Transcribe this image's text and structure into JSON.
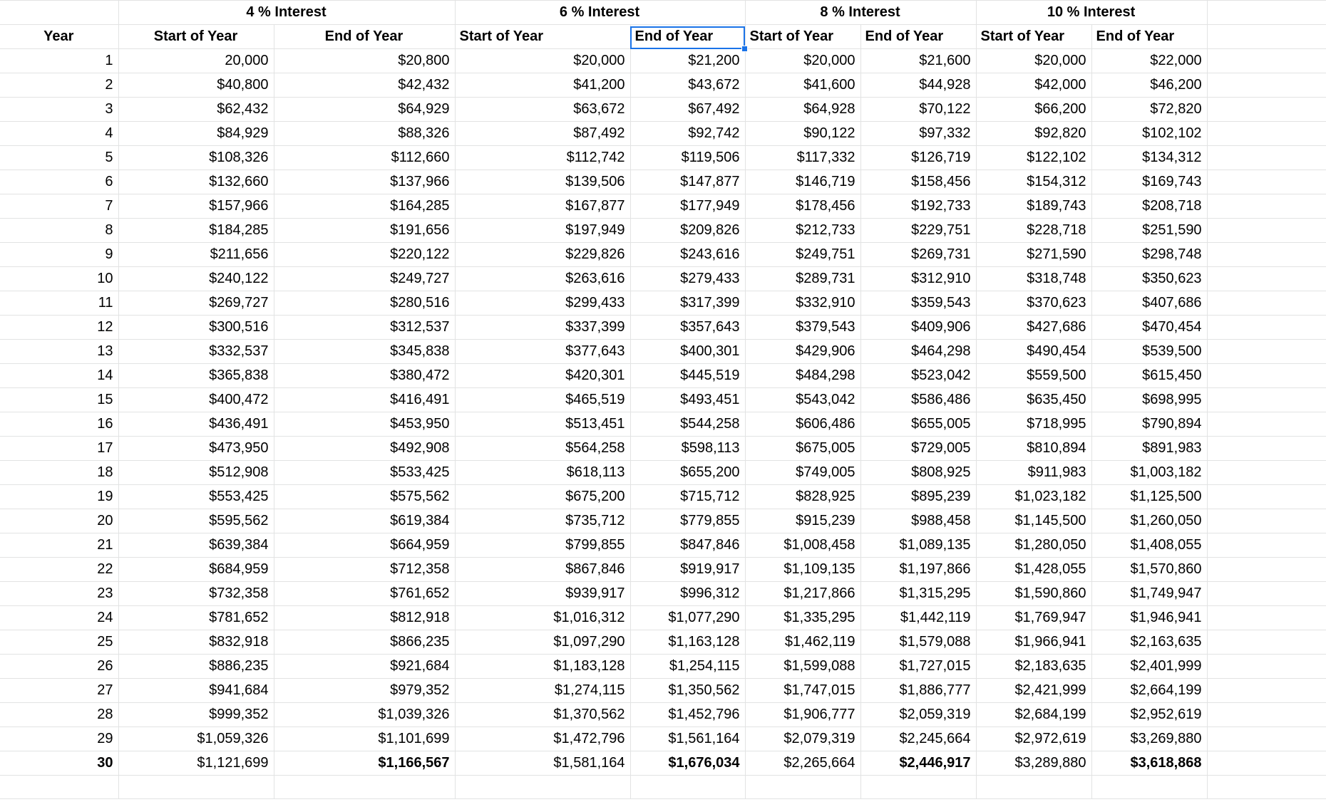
{
  "headers": {
    "year": "Year",
    "groups": [
      "4 % Interest",
      "6 % Interest",
      "8 % Interest",
      "10 % Interest"
    ],
    "start": "Start of Year",
    "end": "End of Year"
  },
  "selected_cell": "6 % Interest / End of Year",
  "rows": [
    [
      "1",
      "20,000",
      "$20,800",
      "$20,000",
      "$21,200",
      "$20,000",
      "$21,600",
      "$20,000",
      "$22,000"
    ],
    [
      "2",
      "$40,800",
      "$42,432",
      "$41,200",
      "$43,672",
      "$41,600",
      "$44,928",
      "$42,000",
      "$46,200"
    ],
    [
      "3",
      "$62,432",
      "$64,929",
      "$63,672",
      "$67,492",
      "$64,928",
      "$70,122",
      "$66,200",
      "$72,820"
    ],
    [
      "4",
      "$84,929",
      "$88,326",
      "$87,492",
      "$92,742",
      "$90,122",
      "$97,332",
      "$92,820",
      "$102,102"
    ],
    [
      "5",
      "$108,326",
      "$112,660",
      "$112,742",
      "$119,506",
      "$117,332",
      "$126,719",
      "$122,102",
      "$134,312"
    ],
    [
      "6",
      "$132,660",
      "$137,966",
      "$139,506",
      "$147,877",
      "$146,719",
      "$158,456",
      "$154,312",
      "$169,743"
    ],
    [
      "7",
      "$157,966",
      "$164,285",
      "$167,877",
      "$177,949",
      "$178,456",
      "$192,733",
      "$189,743",
      "$208,718"
    ],
    [
      "8",
      "$184,285",
      "$191,656",
      "$197,949",
      "$209,826",
      "$212,733",
      "$229,751",
      "$228,718",
      "$251,590"
    ],
    [
      "9",
      "$211,656",
      "$220,122",
      "$229,826",
      "$243,616",
      "$249,751",
      "$269,731",
      "$271,590",
      "$298,748"
    ],
    [
      "10",
      "$240,122",
      "$249,727",
      "$263,616",
      "$279,433",
      "$289,731",
      "$312,910",
      "$318,748",
      "$350,623"
    ],
    [
      "11",
      "$269,727",
      "$280,516",
      "$299,433",
      "$317,399",
      "$332,910",
      "$359,543",
      "$370,623",
      "$407,686"
    ],
    [
      "12",
      "$300,516",
      "$312,537",
      "$337,399",
      "$357,643",
      "$379,543",
      "$409,906",
      "$427,686",
      "$470,454"
    ],
    [
      "13",
      "$332,537",
      "$345,838",
      "$377,643",
      "$400,301",
      "$429,906",
      "$464,298",
      "$490,454",
      "$539,500"
    ],
    [
      "14",
      "$365,838",
      "$380,472",
      "$420,301",
      "$445,519",
      "$484,298",
      "$523,042",
      "$559,500",
      "$615,450"
    ],
    [
      "15",
      "$400,472",
      "$416,491",
      "$465,519",
      "$493,451",
      "$543,042",
      "$586,486",
      "$635,450",
      "$698,995"
    ],
    [
      "16",
      "$436,491",
      "$453,950",
      "$513,451",
      "$544,258",
      "$606,486",
      "$655,005",
      "$718,995",
      "$790,894"
    ],
    [
      "17",
      "$473,950",
      "$492,908",
      "$564,258",
      "$598,113",
      "$675,005",
      "$729,005",
      "$810,894",
      "$891,983"
    ],
    [
      "18",
      "$512,908",
      "$533,425",
      "$618,113",
      "$655,200",
      "$749,005",
      "$808,925",
      "$911,983",
      "$1,003,182"
    ],
    [
      "19",
      "$553,425",
      "$575,562",
      "$675,200",
      "$715,712",
      "$828,925",
      "$895,239",
      "$1,023,182",
      "$1,125,500"
    ],
    [
      "20",
      "$595,562",
      "$619,384",
      "$735,712",
      "$779,855",
      "$915,239",
      "$988,458",
      "$1,145,500",
      "$1,260,050"
    ],
    [
      "21",
      "$639,384",
      "$664,959",
      "$799,855",
      "$847,846",
      "$1,008,458",
      "$1,089,135",
      "$1,280,050",
      "$1,408,055"
    ],
    [
      "22",
      "$684,959",
      "$712,358",
      "$867,846",
      "$919,917",
      "$1,109,135",
      "$1,197,866",
      "$1,428,055",
      "$1,570,860"
    ],
    [
      "23",
      "$732,358",
      "$761,652",
      "$939,917",
      "$996,312",
      "$1,217,866",
      "$1,315,295",
      "$1,590,860",
      "$1,749,947"
    ],
    [
      "24",
      "$781,652",
      "$812,918",
      "$1,016,312",
      "$1,077,290",
      "$1,335,295",
      "$1,442,119",
      "$1,769,947",
      "$1,946,941"
    ],
    [
      "25",
      "$832,918",
      "$866,235",
      "$1,097,290",
      "$1,163,128",
      "$1,462,119",
      "$1,579,088",
      "$1,966,941",
      "$2,163,635"
    ],
    [
      "26",
      "$886,235",
      "$921,684",
      "$1,183,128",
      "$1,254,115",
      "$1,599,088",
      "$1,727,015",
      "$2,183,635",
      "$2,401,999"
    ],
    [
      "27",
      "$941,684",
      "$979,352",
      "$1,274,115",
      "$1,350,562",
      "$1,747,015",
      "$1,886,777",
      "$2,421,999",
      "$2,664,199"
    ],
    [
      "28",
      "$999,352",
      "$1,039,326",
      "$1,370,562",
      "$1,452,796",
      "$1,906,777",
      "$2,059,319",
      "$2,684,199",
      "$2,952,619"
    ],
    [
      "29",
      "$1,059,326",
      "$1,101,699",
      "$1,472,796",
      "$1,561,164",
      "$2,079,319",
      "$2,245,664",
      "$2,972,619",
      "$3,269,880"
    ],
    [
      "30",
      "$1,121,699",
      "$1,166,567",
      "$1,581,164",
      "$1,676,034",
      "$2,265,664",
      "$2,446,917",
      "$3,289,880",
      "$3,618,868"
    ]
  ],
  "colors": {
    "gridline": "#e2e3e3",
    "selection": "#1a73e8"
  }
}
